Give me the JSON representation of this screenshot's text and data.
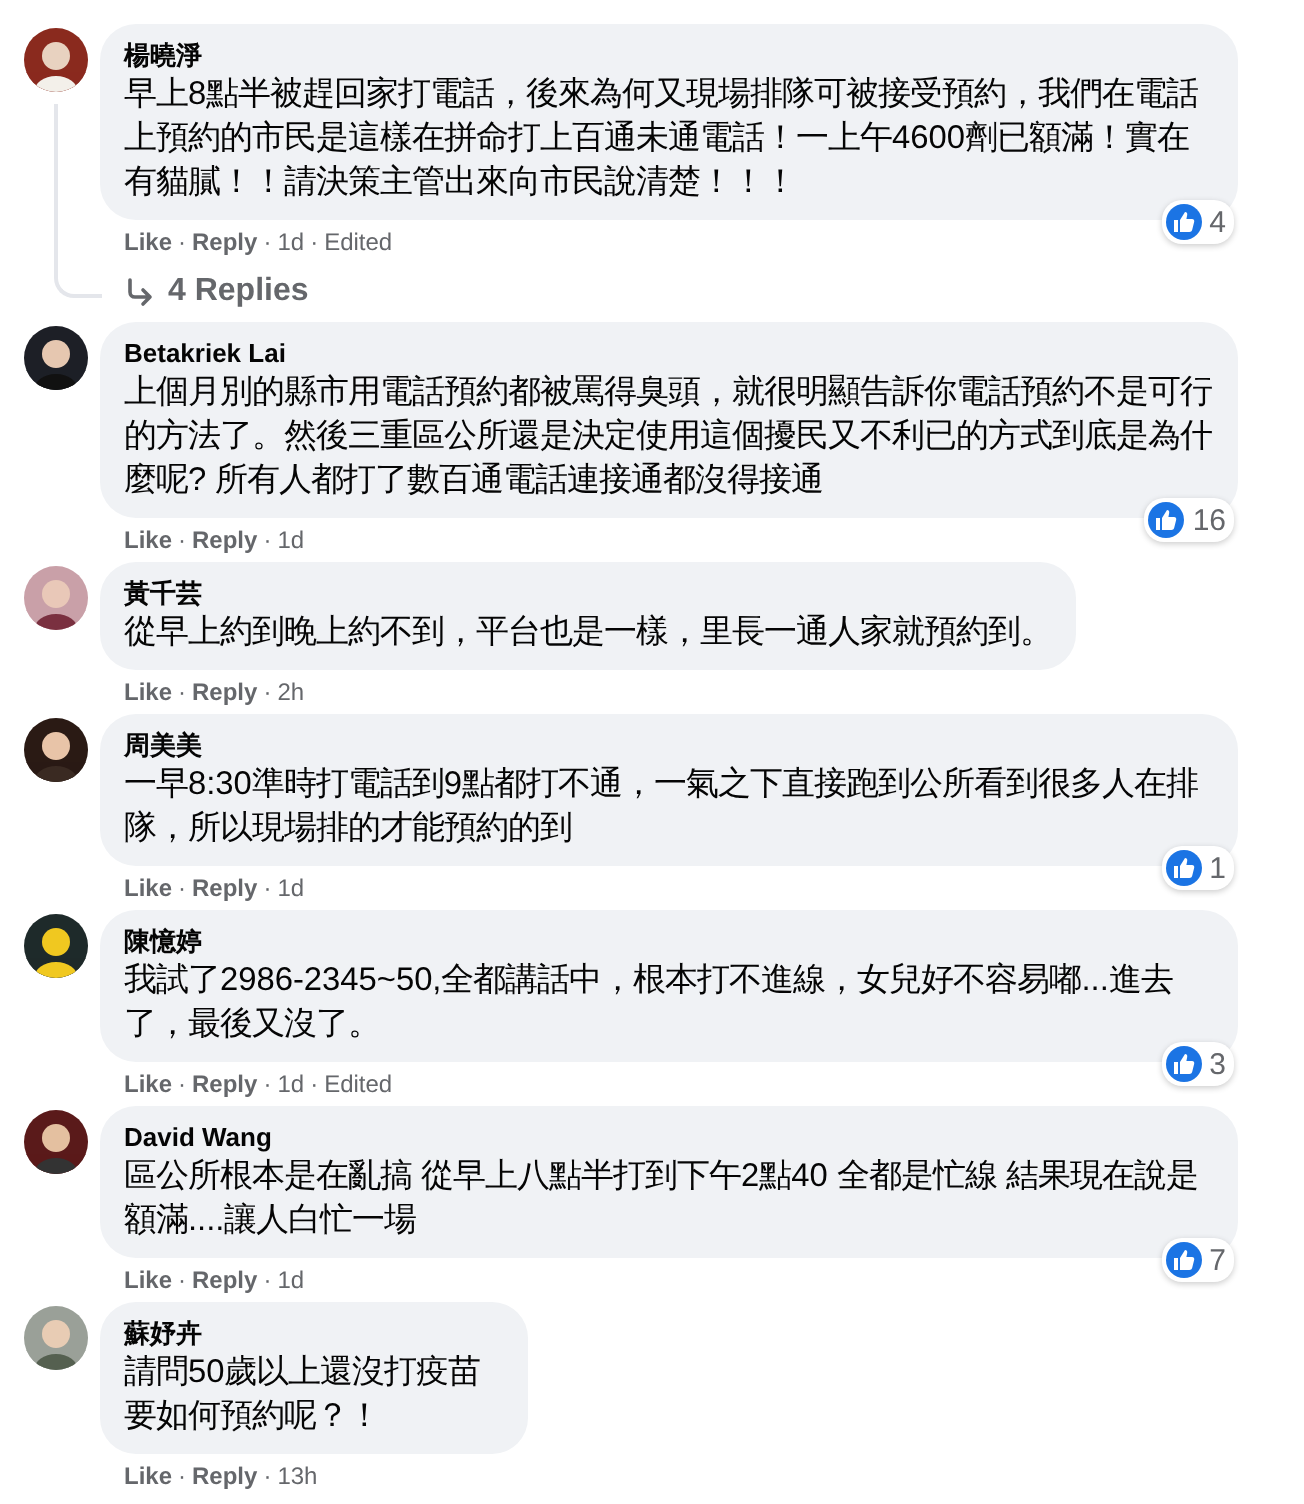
{
  "separator": "·",
  "comments": [
    {
      "author": "楊曉淨",
      "avatar": {
        "kind": "picture"
      },
      "text": "早上8點半被趕回家打電話，後來為何又現場排隊可被接受預約，我們在電話上預約的市民是這樣在拼命打上百通未通電話！一上午4600劑已額滿！實在有貓膩！！請決策主管出來向市民說清楚！！！",
      "actions": [
        "Like",
        "Reply"
      ],
      "meta": [
        "1d",
        "Edited"
      ],
      "reactions": "4",
      "replies": "4 Replies"
    },
    {
      "author": "Betakriek Lai",
      "avatar": {
        "kind": "picture"
      },
      "text": "上個月別的縣市用電話預約都被罵得臭頭，就很明顯告訴你電話預約不是可行的方法了。然後三重區公所還是決定使用這個擾民又不利已的方式到底是為什麼呢? 所有人都打了數百通電話連接通都沒得接通",
      "actions": [
        "Like",
        "Reply"
      ],
      "meta": [
        "1d"
      ],
      "reactions": "16"
    },
    {
      "author": "黃千芸",
      "avatar": {
        "kind": "picture"
      },
      "text": "從早上約到晚上約不到，平台也是一樣，里長一通人家就預約到。",
      "actions": [
        "Like",
        "Reply"
      ],
      "meta": [
        "2h"
      ]
    },
    {
      "author": "周美美",
      "avatar": {
        "kind": "picture"
      },
      "text": "一早8:30準時打電話到9點都打不通，一氣之下直接跑到公所看到很多人在排隊，所以現場排的才能預約的到",
      "actions": [
        "Like",
        "Reply"
      ],
      "meta": [
        "1d"
      ],
      "reactions": "1"
    },
    {
      "author": "陳憶婷",
      "avatar": {
        "kind": "picture"
      },
      "text": "我試了2986-2345~50,全都講話中，根本打不進線，女兒好不容易嘟...進去了，最後又沒了。",
      "actions": [
        "Like",
        "Reply"
      ],
      "meta": [
        "1d",
        "Edited"
      ],
      "reactions": "3"
    },
    {
      "author": "David Wang",
      "avatar": {
        "kind": "picture"
      },
      "text": "區公所根本是在亂搞 從早上八點半打到下午2點40 全都是忙線 結果現在說是額滿....讓人白忙一場",
      "actions": [
        "Like",
        "Reply"
      ],
      "meta": [
        "1d"
      ],
      "reactions": "7"
    },
    {
      "author": "蘇妤卉",
      "avatar": {
        "kind": "picture"
      },
      "text": "請問50歲以上還沒打疫苗要如何預約呢？！",
      "actions": [
        "Like",
        "Reply"
      ],
      "meta": [
        "13h"
      ]
    }
  ]
}
